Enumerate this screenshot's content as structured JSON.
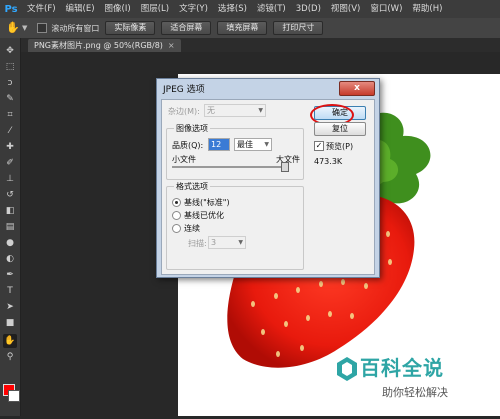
{
  "app": {
    "logo": "Ps"
  },
  "menu": [
    "文件(F)",
    "编辑(E)",
    "图像(I)",
    "图层(L)",
    "文字(Y)",
    "选择(S)",
    "滤镜(T)",
    "3D(D)",
    "视图(V)",
    "窗口(W)",
    "帮助(H)"
  ],
  "options_bar": {
    "scroll_all_label": "滚动所有窗口",
    "buttons": [
      "实际像素",
      "适合屏幕",
      "填充屏幕",
      "打印尺寸"
    ]
  },
  "document": {
    "tab_title": "PNG素材图片.png @ 50%(RGB/8)"
  },
  "tools": [
    "move-tool-icon",
    "marquee-tool-icon",
    "lasso-tool-icon",
    "quick-select-tool-icon",
    "crop-tool-icon",
    "eyedropper-tool-icon",
    "healing-brush-icon",
    "brush-tool-icon",
    "clone-stamp-icon",
    "history-brush-icon",
    "eraser-tool-icon",
    "gradient-tool-icon",
    "blur-tool-icon",
    "dodge-tool-icon",
    "pen-tool-icon",
    "type-tool-icon",
    "path-select-icon",
    "shape-tool-icon",
    "hand-tool-icon",
    "zoom-tool-icon"
  ],
  "colors": {
    "foreground": "#ff0000",
    "background": "#ffffff",
    "watermark": "#2ea5a5"
  },
  "dialog": {
    "title": "JPEG 选项",
    "close_label": "x",
    "matte_label": "杂边(M):",
    "matte_value": "无",
    "image_options_group": "图像选项",
    "quality_label": "品质(Q):",
    "quality_value": "12",
    "quality_preset": "最佳",
    "small_file_label": "小文件",
    "large_file_label": "大文件",
    "quality_slider_fraction": 1.0,
    "format_options_group": "格式选项",
    "format_options": [
      "基线(\"标准\")",
      "基线已优化",
      "连续"
    ],
    "selected_format_index": 0,
    "scans_label": "扫描:",
    "scans_value": "3",
    "ok_label": "确定",
    "reset_label": "复位",
    "preview_label": "预览(P)",
    "preview_checked": true,
    "file_size": "473.3K"
  },
  "watermark": {
    "line1": "百科全说",
    "line2": "助你轻松解决"
  }
}
